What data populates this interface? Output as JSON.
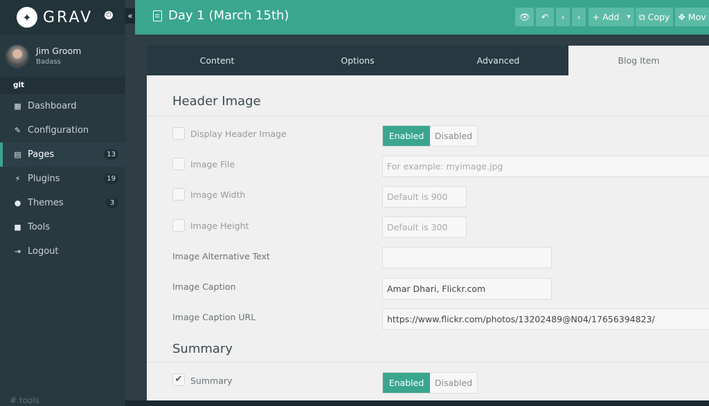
{
  "app": {
    "name": "GRAV",
    "collapse_glyph": "«"
  },
  "user": {
    "name": "Jim Groom",
    "role": "Badass"
  },
  "site": "git",
  "nav": [
    {
      "label": "Dashboard",
      "icon": "grid-icon",
      "glyph": "▦"
    },
    {
      "label": "Configuration",
      "icon": "wrench-icon",
      "glyph": "✎"
    },
    {
      "label": "Pages",
      "icon": "file-icon",
      "glyph": "▤",
      "badge": "13",
      "active": true
    },
    {
      "label": "Plugins",
      "icon": "plug-icon",
      "glyph": "⚡",
      "badge": "19"
    },
    {
      "label": "Themes",
      "icon": "drop-icon",
      "glyph": "●",
      "badge": "3"
    },
    {
      "label": "Tools",
      "icon": "briefcase-icon",
      "glyph": "■"
    },
    {
      "label": "Logout",
      "icon": "sign-out-icon",
      "glyph": "⇥"
    }
  ],
  "sidebar_footer": "# tools",
  "header": {
    "title": "Day 1 (March 15th)",
    "buttons": {
      "preview": "👁",
      "back": "↶",
      "prev": "‹",
      "next": "›",
      "add": "+ Add",
      "add_caret": "▾",
      "copy": "⧉ Copy",
      "move": "✥ Mov"
    }
  },
  "tabs": [
    {
      "label": "Content"
    },
    {
      "label": "Options"
    },
    {
      "label": "Advanced"
    },
    {
      "label": "Blog Item",
      "active": true
    }
  ],
  "header_image": {
    "title": "Header Image",
    "display": {
      "label": "Display Header Image",
      "enabled": "Enabled",
      "disabled": "Disabled",
      "value": "Enabled"
    },
    "file": {
      "label": "Image File",
      "placeholder": "For example: myimage.jpg"
    },
    "width": {
      "label": "Image Width",
      "placeholder": "Default is 900"
    },
    "height": {
      "label": "Image Height",
      "placeholder": "Default is 300"
    },
    "alt": {
      "label": "Image Alternative Text",
      "value": ""
    },
    "caption": {
      "label": "Image Caption",
      "value": "Amar Dhari, Flickr.com"
    },
    "caption_url": {
      "label": "Image Caption URL",
      "value": "https://www.flickr.com/photos/13202489@N04/17656394823/"
    }
  },
  "summary": {
    "title": "Summary",
    "toggle": {
      "label": "Summary",
      "checked": true,
      "check_glyph": "✔",
      "enabled": "Enabled",
      "disabled": "Disabled",
      "value": "Enabled"
    }
  },
  "colors": {
    "accent": "#3aa68e",
    "sidebar": "#283940",
    "panel": "#f0f0f0"
  }
}
